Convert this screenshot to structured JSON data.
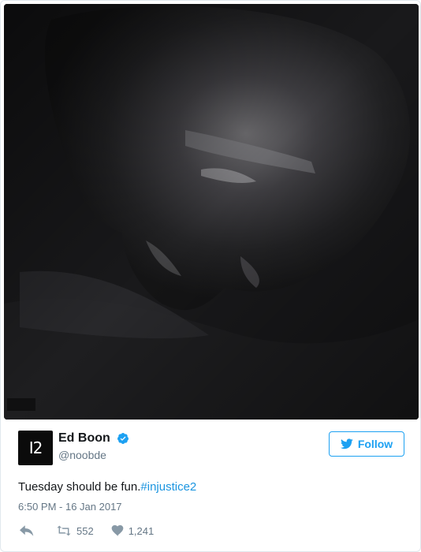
{
  "author": {
    "display_name": "Ed Boon",
    "handle": "@noobde",
    "avatar_text": "I2",
    "verified": true
  },
  "follow_button": {
    "label": "Follow",
    "icon": "twitter-bird-icon"
  },
  "tweet": {
    "text": "Tuesday should be fun.",
    "hashtag": "#injustice2",
    "timestamp": "6:50 PM - 16 Jan 2017"
  },
  "actions": {
    "reply_icon": "reply-icon",
    "retweet_icon": "retweet-icon",
    "retweet_count": "552",
    "like_icon": "heart-icon",
    "like_count": "1,241"
  },
  "colors": {
    "accent": "#1da1f2",
    "link": "#1b95e0",
    "muted": "#657786",
    "verified": "#1da1f2"
  }
}
